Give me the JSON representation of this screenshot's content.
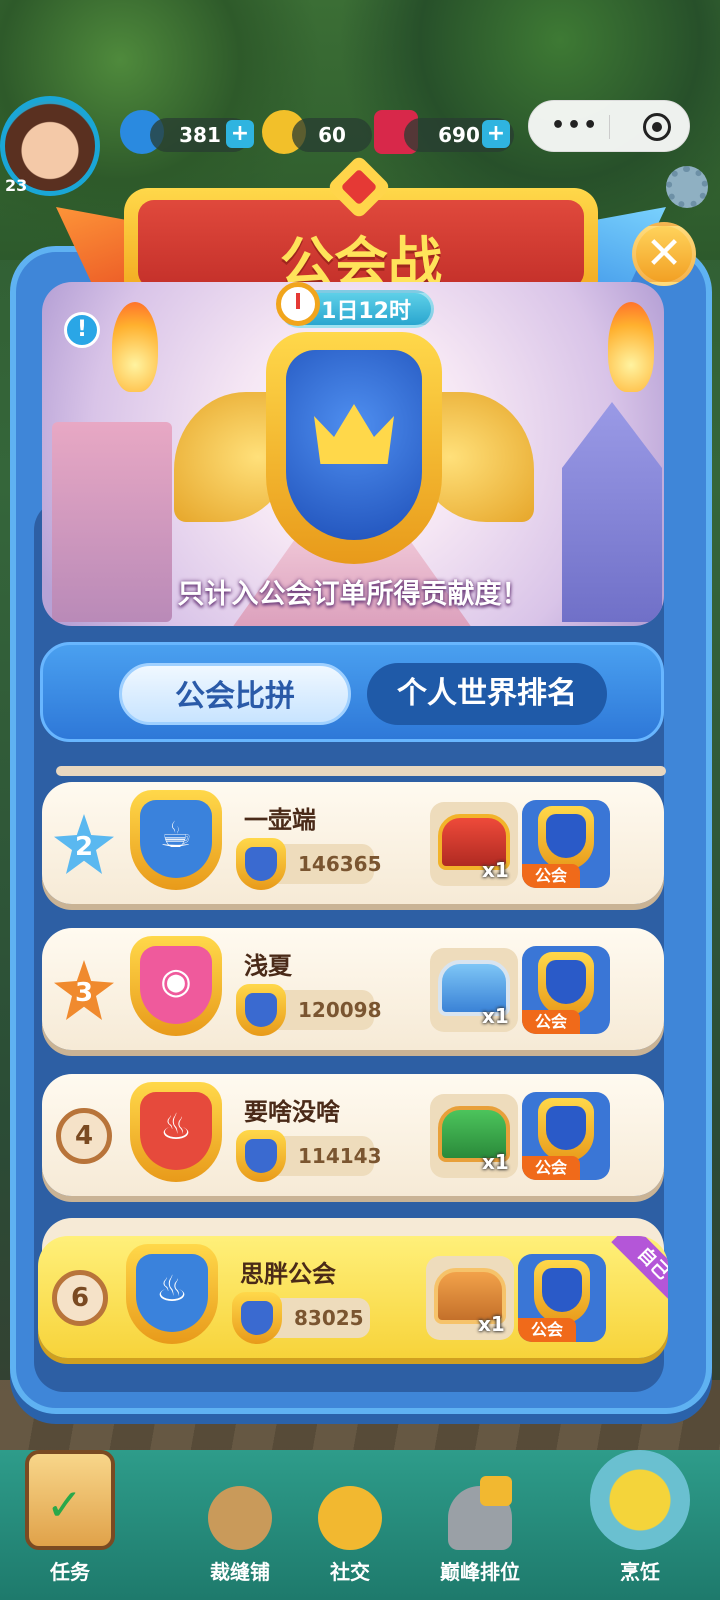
{
  "hud": {
    "avatar_level": "23",
    "energy": "381",
    "coins": "60",
    "gems": "690",
    "plus": "+"
  },
  "miniprogram": {
    "more_glyph": "•••"
  },
  "modal": {
    "title": "公会战",
    "timer": "1日12时",
    "close_glyph": "✕",
    "info_glyph": "!",
    "caption": "只计入公会订单所得贡献度！"
  },
  "tabs": {
    "active": "公会比拼",
    "inactive": "个人世界排名"
  },
  "rows": [
    {
      "rank": "2",
      "name": "一壶端",
      "score": "146365",
      "qty": "x1",
      "tag": "公会",
      "icon": "teapot-icon"
    },
    {
      "rank": "3",
      "name": "浅夏",
      "score": "120098",
      "qty": "x1",
      "tag": "公会",
      "icon": "bun-icon"
    },
    {
      "rank": "4",
      "name": "要啥没啥",
      "score": "114143",
      "qty": "x1",
      "tag": "公会",
      "icon": "noodle-bowl-icon"
    }
  ],
  "self_row": {
    "rank": "6",
    "name": "思胖公会",
    "score": "83025",
    "qty": "x1",
    "tag": "公会",
    "ribbon": "自己",
    "icon": "rice-bowl-icon"
  },
  "bottom_nav": {
    "task": "任务",
    "tailor": "裁缝铺",
    "social": "社交",
    "rank": "巅峰排位",
    "cook": "烹饪"
  },
  "colors": {
    "panel": "#3f86d8",
    "banner_red": "#c4302a",
    "gold": "#ffd84a",
    "self_row": "#f7d33a",
    "nav": "#1e7a6c"
  }
}
